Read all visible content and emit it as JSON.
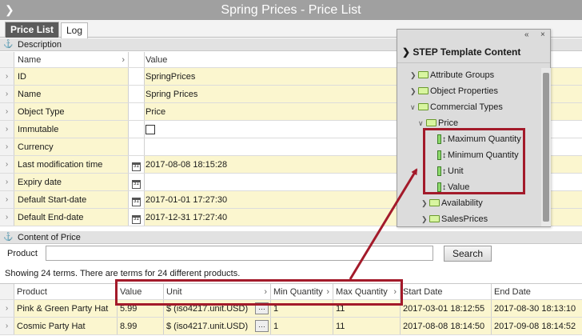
{
  "window": {
    "title": "Spring Prices - Price List"
  },
  "tabs": [
    {
      "label": "Price List",
      "active": true
    },
    {
      "label": "Log",
      "active": false
    }
  ],
  "description": {
    "section_label": "Description",
    "headers": {
      "name": "Name",
      "value": "Value"
    },
    "rows": [
      {
        "name": "ID",
        "value": "SpringPrices"
      },
      {
        "name": "Name",
        "value": "Spring Prices"
      },
      {
        "name": "Object Type",
        "value": "Price"
      },
      {
        "name": "Immutable",
        "value": ""
      },
      {
        "name": "Currency",
        "value": ""
      },
      {
        "name": "Last modification time",
        "value": "2017-08-08 18:15:28"
      },
      {
        "name": "Expiry date",
        "value": ""
      },
      {
        "name": "Default Start-date",
        "value": "2017-01-01 17:27:30"
      },
      {
        "name": "Default End-date",
        "value": "2017-12-31 17:27:40"
      }
    ]
  },
  "content": {
    "section_label": "Content of Price",
    "product_label": "Product",
    "product_value": "",
    "search_label": "Search",
    "status": "Showing 24 terms. There are terms for 24 different products.",
    "columns": {
      "product": "Product",
      "value": "Value",
      "unit": "Unit",
      "min_qty": "Min Quantity",
      "max_qty": "Max Quantity",
      "start": "Start Date",
      "end": "End Date"
    },
    "rows": [
      {
        "product": "Pink & Green Party Hat",
        "value": "5.99",
        "unit": "$ (iso4217.unit.USD)",
        "min_qty": "1",
        "max_qty": "11",
        "start": "2017-03-01 18:12:55",
        "end": "2017-08-30 18:13:10"
      },
      {
        "product": "Cosmic Party Hat",
        "value": "8.99",
        "unit": "$ (iso4217.unit.USD)",
        "min_qty": "1",
        "max_qty": "11",
        "start": "2017-08-08 18:14:50",
        "end": "2017-09-08 18:14:52"
      }
    ]
  },
  "panel": {
    "title": "STEP Template Content",
    "controls": {
      "collapse": "«",
      "close": "×"
    },
    "tree": [
      {
        "label": "Attribute Groups"
      },
      {
        "label": "Object Properties"
      },
      {
        "label": "Commercial Types"
      },
      {
        "label": "Price"
      },
      {
        "label": "Maximum Quantity"
      },
      {
        "label": "Minimum Quantity"
      },
      {
        "label": "Unit"
      },
      {
        "label": "Value"
      },
      {
        "label": "Availability"
      },
      {
        "label": "SalesPrices"
      }
    ]
  },
  "annotation": {
    "color": "#a31a2a"
  }
}
